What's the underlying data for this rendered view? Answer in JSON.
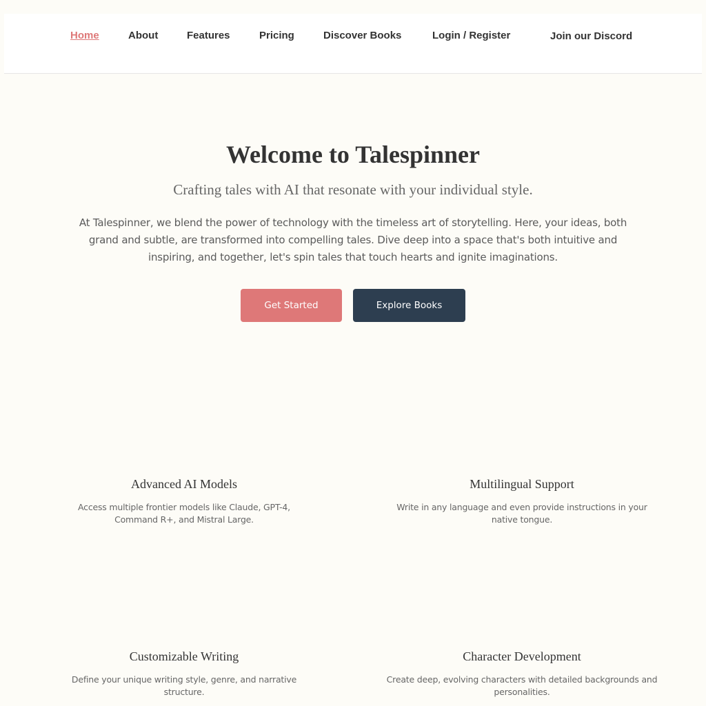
{
  "nav": {
    "items": [
      {
        "label": "Home",
        "active": true
      },
      {
        "label": "About",
        "active": false
      },
      {
        "label": "Features",
        "active": false
      },
      {
        "label": "Pricing",
        "active": false
      },
      {
        "label": "Discover Books",
        "active": false
      },
      {
        "label": "Login / Register",
        "active": false
      }
    ],
    "discord_label": "Join our Discord"
  },
  "hero": {
    "title": "Welcome to Talespinner",
    "subtitle": "Crafting tales with AI that resonate with your individual style.",
    "body": "At Talespinner, we blend the power of technology with the timeless art of storytelling. Here, your ideas, both grand and subtle, are transformed into compelling tales. Dive deep into a space that's both intuitive and inspiring, and together, let's spin tales that touch hearts and ignite imaginations.",
    "primary_button": "Get Started",
    "secondary_button": "Explore Books"
  },
  "features": [
    {
      "title": "Advanced AI Models",
      "description": "Access multiple frontier models like Claude, GPT-4, Command R+, and Mistral Large."
    },
    {
      "title": "Multilingual Support",
      "description": "Write in any language and even provide instructions in your native tongue."
    },
    {
      "title": "Customizable Writing",
      "description": "Define your unique writing style, genre, and narrative structure."
    },
    {
      "title": "Character Development",
      "description": "Create deep, evolving characters with detailed backgrounds and personalities."
    }
  ],
  "colors": {
    "accent": "#de7878",
    "dark": "#2d3e50",
    "background": "#fdfcf7",
    "text": "#333333"
  }
}
